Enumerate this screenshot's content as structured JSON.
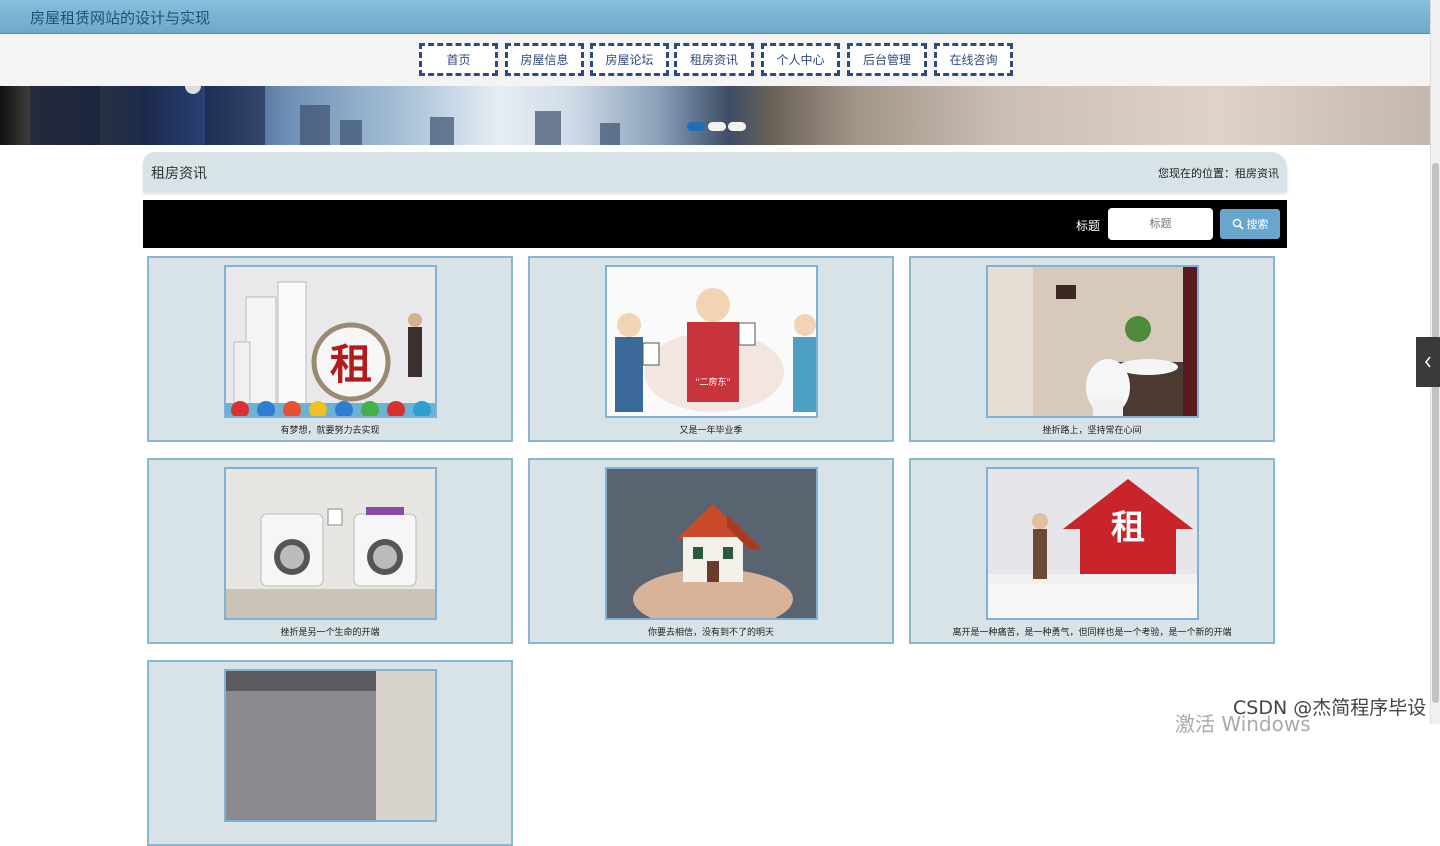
{
  "site": {
    "title": "房屋租赁网站的设计与实现"
  },
  "nav": {
    "items": [
      "首页",
      "房屋信息",
      "房屋论坛",
      "租房资讯",
      "个人中心",
      "后台管理",
      "在线咨询"
    ]
  },
  "breadcrumb": {
    "title": "租房资讯",
    "location": "您现在的位置：租房资讯"
  },
  "search": {
    "label": "标题",
    "placeholder": "标题",
    "button": "搜索"
  },
  "news": [
    {
      "caption": "有梦想，就要努力去实现"
    },
    {
      "caption": "又是一年毕业季"
    },
    {
      "caption": "挫折路上，坚持常在心间"
    },
    {
      "caption": "挫折是另一个生命的开端"
    },
    {
      "caption": "你要去相信，没有到不了的明天"
    },
    {
      "caption": "离开是一种痛苦，是一种勇气，但同样也是一个考验，是一个新的开端"
    },
    {
      "caption": ""
    }
  ],
  "overlay": {
    "watermark": "CSDN @杰简程序毕设",
    "windows": "激活 Windows"
  },
  "colors": {
    "topbar": "#7ab4d4",
    "nav_border": "#2e4a7e",
    "search_button": "#68a6cd",
    "card_bg": "#d7e3e6"
  }
}
